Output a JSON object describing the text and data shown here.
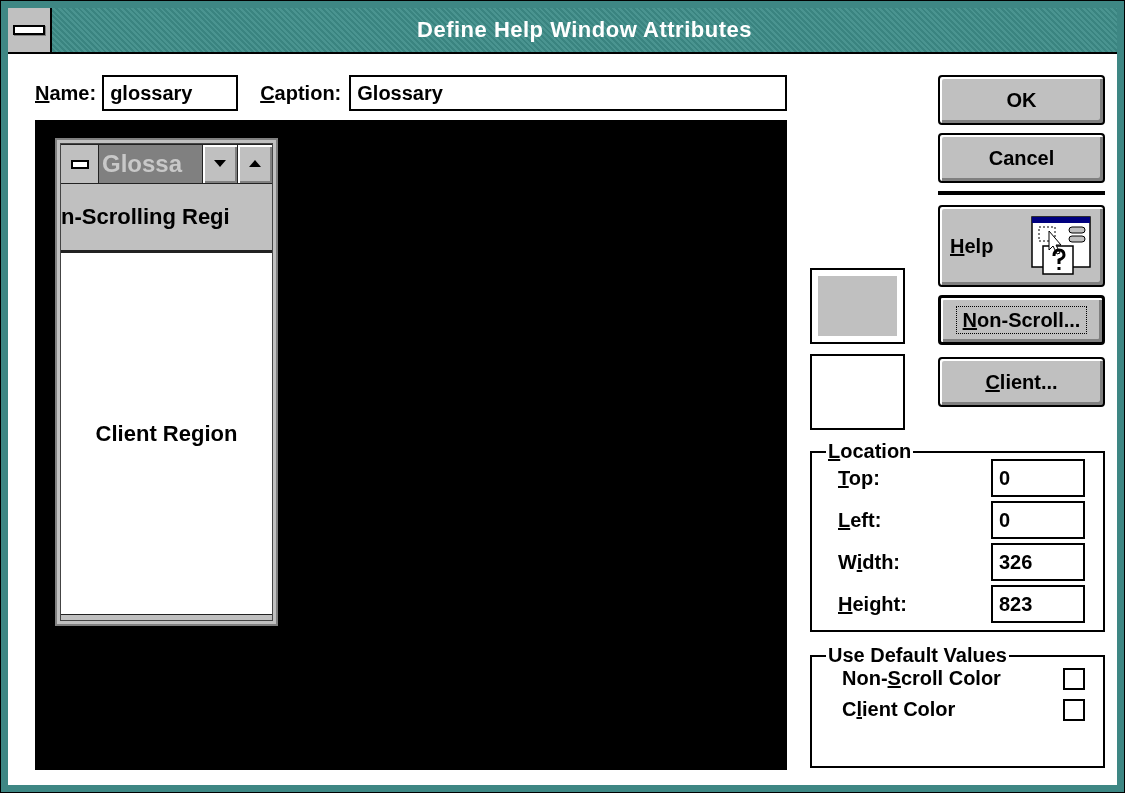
{
  "window": {
    "title": "Define Help Window Attributes"
  },
  "name_field": {
    "label": [
      {
        "text": "N",
        "underline": true
      },
      {
        "text": "ame:",
        "underline": false
      }
    ],
    "value": "glossary"
  },
  "caption_field": {
    "label": [
      {
        "text": "C",
        "underline": true
      },
      {
        "text": "aption:",
        "underline": false
      }
    ],
    "value": "Glossary"
  },
  "preview": {
    "caption": "Glossa",
    "non_scrolling_region": "n-Scrolling Regi",
    "client_region": "Client Region"
  },
  "buttons": [
    {
      "label": [
        {
          "text": "OK",
          "underline": false
        }
      ],
      "kind": "push",
      "default": false
    },
    {
      "label": [
        {
          "text": "Cancel",
          "underline": false
        }
      ],
      "kind": "push",
      "default": false
    },
    {
      "kind": "separator"
    },
    {
      "label": [
        {
          "text": "H",
          "underline": true
        },
        {
          "text": "elp",
          "underline": false
        }
      ],
      "kind": "icon",
      "default": false
    },
    {
      "label": [
        {
          "text": "N",
          "underline": true
        },
        {
          "text": "on-Scroll...",
          "underline": false
        }
      ],
      "kind": "push",
      "default": true
    },
    {
      "label": [
        {
          "text": "C",
          "underline": true
        },
        {
          "text": "lient...",
          "underline": false
        }
      ],
      "kind": "push",
      "default": false
    }
  ],
  "swatches": [
    {
      "color": "#c0c0c0"
    },
    {
      "color": "#ffffff"
    }
  ],
  "location": {
    "title": [
      {
        "text": "L",
        "underline": true
      },
      {
        "text": "ocation",
        "underline": false
      }
    ],
    "fields": [
      {
        "label": [
          {
            "text": "T",
            "underline": true
          },
          {
            "text": "op:",
            "underline": false
          }
        ],
        "value": "0"
      },
      {
        "label": [
          {
            "text": "L",
            "underline": true
          },
          {
            "text": "eft:",
            "underline": false
          }
        ],
        "value": "0"
      },
      {
        "label": [
          {
            "text": "W",
            "underline": false
          },
          {
            "text": "i",
            "underline": true
          },
          {
            "text": "dth:",
            "underline": false
          }
        ],
        "value": "326"
      },
      {
        "label": [
          {
            "text": "H",
            "underline": true
          },
          {
            "text": "eight:",
            "underline": false
          }
        ],
        "value": "823"
      }
    ]
  },
  "defaults": {
    "title": [
      {
        "text": "Use Default Values",
        "underline": false
      }
    ],
    "options": [
      {
        "label": [
          {
            "text": "Non-",
            "underline": false
          },
          {
            "text": "S",
            "underline": true
          },
          {
            "text": "croll Color",
            "underline": false
          }
        ],
        "checked": false
      },
      {
        "label": [
          {
            "text": "C",
            "underline": false
          },
          {
            "text": "l",
            "underline": true
          },
          {
            "text": "ient Color",
            "underline": false
          }
        ],
        "checked": false
      }
    ]
  }
}
